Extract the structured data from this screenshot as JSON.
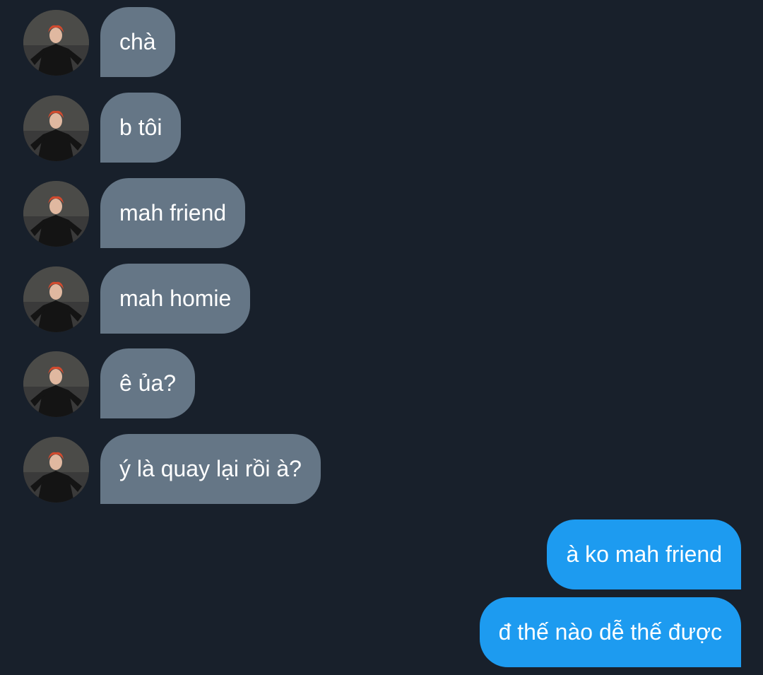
{
  "conversation": {
    "received": [
      {
        "text": "chà"
      },
      {
        "text": "b tôi"
      },
      {
        "text": "mah friend"
      },
      {
        "text": "mah homie"
      },
      {
        "text": "ê ủa?"
      },
      {
        "text": "ý là quay lại rồi à?"
      }
    ],
    "sent": [
      {
        "text": "à ko mah friend"
      },
      {
        "text": "đ thế nào dễ thế được"
      }
    ]
  },
  "colors": {
    "background": "#18202b",
    "received_bubble": "#657686",
    "sent_bubble": "#1d9bf0",
    "text": "#ffffff"
  }
}
